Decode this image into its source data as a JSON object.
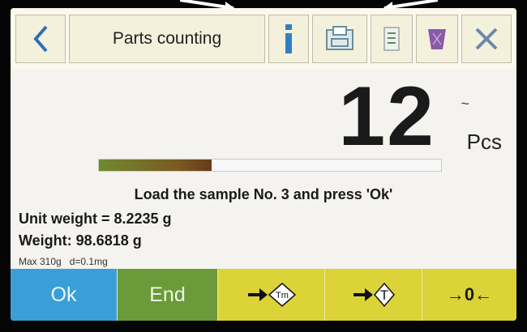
{
  "header": {
    "back_icon": "chevron-left-icon",
    "title": "Parts counting",
    "actions": [
      "info-icon",
      "print-icon",
      "list-icon",
      "trash-icon",
      "close-icon"
    ]
  },
  "display": {
    "count": "12",
    "stability_mark": "~",
    "unit": "Pcs"
  },
  "progress": {
    "fraction": 0.33
  },
  "instruction": "Load the sample No. 3 and press 'Ok'",
  "readings": {
    "unit_weight": "Unit weight = 8.2235 g",
    "weight": "Weight: 98.6818 g"
  },
  "capacity": {
    "max": "Max 310g",
    "division": "d=0.1mg"
  },
  "footer": {
    "ok_label": "Ok",
    "end_label": "End",
    "tare_memory_label": "Tm",
    "tare_label": "T",
    "zero_label": "→0←"
  },
  "colors": {
    "ok": "#3a9fd6",
    "end": "#6b9a3a",
    "function_keys": "#dcd338",
    "info": "#2f7fc4",
    "trash": "#8b59a8",
    "close": "#6f88a8"
  }
}
